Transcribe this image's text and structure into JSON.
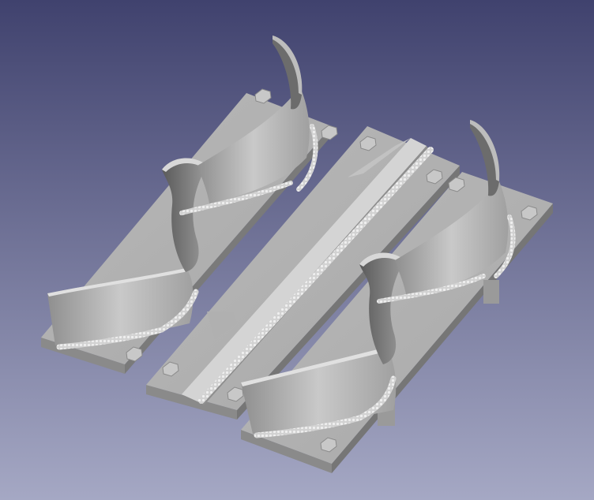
{
  "viewport": {
    "background_top": "#40426e",
    "background_bottom": "#a5a8c4"
  },
  "model": {
    "face_light": "#c7c7c7",
    "face_mid": "#a9a9a9",
    "face_dark": "#7d7d7d",
    "weld_color": "#d6d6d6",
    "parts": [
      "left-plate-assembly",
      "center-plate-assembly",
      "right-plate-assembly"
    ]
  }
}
